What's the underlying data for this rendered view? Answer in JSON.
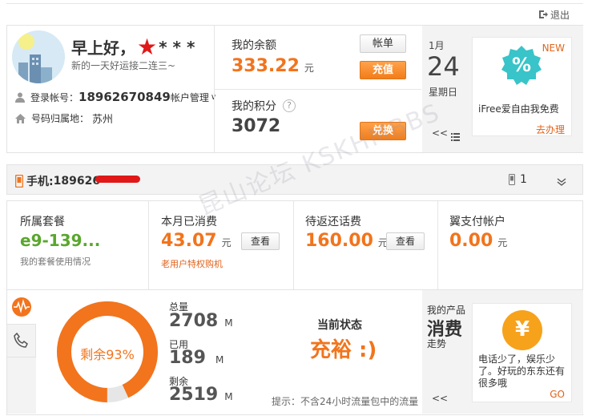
{
  "header": {
    "logout_label": "退出"
  },
  "profile": {
    "greeting": "早上好，",
    "username_masked": "* * *",
    "slogan": "新的一天好运接二连三~",
    "login_label": "登录帐号：",
    "login_value": "18962670849",
    "account_manage_label": "帐户管理",
    "region_label": "号码归属地：",
    "region_value": "苏州"
  },
  "balance": {
    "label": "我的余额",
    "value": "333.22",
    "unit": "元",
    "bill_button": "帐单",
    "recharge_button": "充值"
  },
  "points": {
    "label": "我的积分",
    "help_glyph": "?",
    "value": "3072",
    "exchange_button": "兑换"
  },
  "calendar": {
    "month": "1月",
    "day": "24",
    "weekday": "星期日"
  },
  "promo_top": {
    "badge": "NEW",
    "icon_glyph": "%",
    "text": "iFree爱自由我免费",
    "action": "去办理",
    "prev_glyph": "<<"
  },
  "phone_bar": {
    "label": "手机:",
    "number_masked": "189626",
    "device_count": "1"
  },
  "stats": {
    "plan": {
      "label": "所属套餐",
      "value": "e9-139...",
      "sub": "我的套餐使用情况"
    },
    "spent": {
      "label": "本月已消费",
      "value": "43.07",
      "unit": "元",
      "button": "查看",
      "sub": "老用户特权购机"
    },
    "refund": {
      "label": "待返还话费",
      "value": "160.00",
      "unit": "元",
      "button": "查看"
    },
    "yipay": {
      "label": "翼支付帐户",
      "value": "0.00",
      "unit": "元"
    }
  },
  "usage": {
    "donut_label": "剩余93%",
    "remaining_fraction": 0.93,
    "total_label": "总量",
    "total_value": "2708",
    "used_label": "已用",
    "used_value": "189",
    "remain_label": "剩余",
    "remain_value": "2519",
    "unit": "M",
    "state_label": "当前状态",
    "state_value": "充裕 :)",
    "hint": "提示：不含24小时流量包中的流量"
  },
  "products": {
    "title_small": "我的产品",
    "title_big": "消费",
    "title_sub": "走势",
    "prev_glyph": "<<",
    "icon_glyph": "¥",
    "text": "电话少了，娱乐少了。好玩的东东还有很多哦",
    "action": "GO"
  },
  "watermark": "昆山论坛 KSKHMBBS",
  "colors": {
    "accent": "#f2741c",
    "green": "#5aa72d",
    "teal": "#38c4c9",
    "yen": "#f7a21b"
  }
}
